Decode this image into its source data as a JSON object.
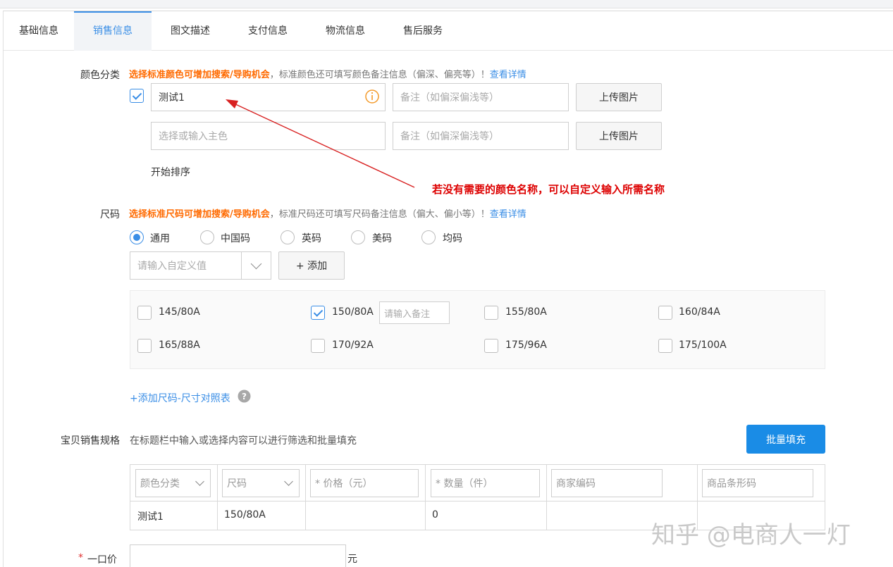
{
  "tabs": [
    "基础信息",
    "销售信息",
    "图文描述",
    "支付信息",
    "物流信息",
    "售后服务"
  ],
  "color": {
    "label": "颜色分类",
    "hint_strong": "选择标准颜色可增加搜索/导购机会",
    "hint_rest": "，标准颜色还可填写颜色备注信息（偏深、偏亮等）！",
    "hint_link": "查看详情",
    "row1_value": "测试1",
    "note_placeholder": "备注（如偏深偏浅等）",
    "upload_label": "上传图片",
    "row2_placeholder": "选择或输入主色",
    "sort_label": "开始排序"
  },
  "annotation": "若没有需要的颜色名称，可以自定义输入所需名称",
  "size": {
    "label": "尺码",
    "hint_strong": "选择标准尺码可增加搜索/导购机会",
    "hint_rest": "，标准尺码还可填写尺码备注信息（偏大、偏小等）！",
    "hint_link": "查看详情",
    "radios": [
      "通用",
      "中国码",
      "英码",
      "美码",
      "均码"
    ],
    "custom_placeholder": "请输入自定义值",
    "add_label": "+ 添加",
    "options": [
      "145/80A",
      "150/80A",
      "155/80A",
      "160/84A",
      "165/88A",
      "170/92A",
      "175/96A",
      "175/100A"
    ],
    "remark_placeholder": "请输入备注",
    "chart_link": "+添加尺码-尺寸对照表"
  },
  "spec": {
    "label": "宝贝销售规格",
    "hint": "在标题栏中输入或选择内容可以进行筛选和批量填充",
    "bulk_label": "批量填充",
    "headers": [
      "颜色分类",
      "尺码",
      "* 价格（元）",
      "* 数量（件）",
      "商家编码",
      "商品条形码"
    ],
    "row": [
      "测试1",
      "150/80A",
      "",
      "0",
      "",
      ""
    ]
  },
  "price": {
    "star": "*",
    "label": "一口价",
    "unit": "元"
  },
  "watermark": "知乎 @电商人一灯",
  "colors": {
    "accent": "#3a8ee6",
    "orange": "#ff6a00",
    "primary": "#1a8ce6",
    "annotation": "#d00000"
  }
}
